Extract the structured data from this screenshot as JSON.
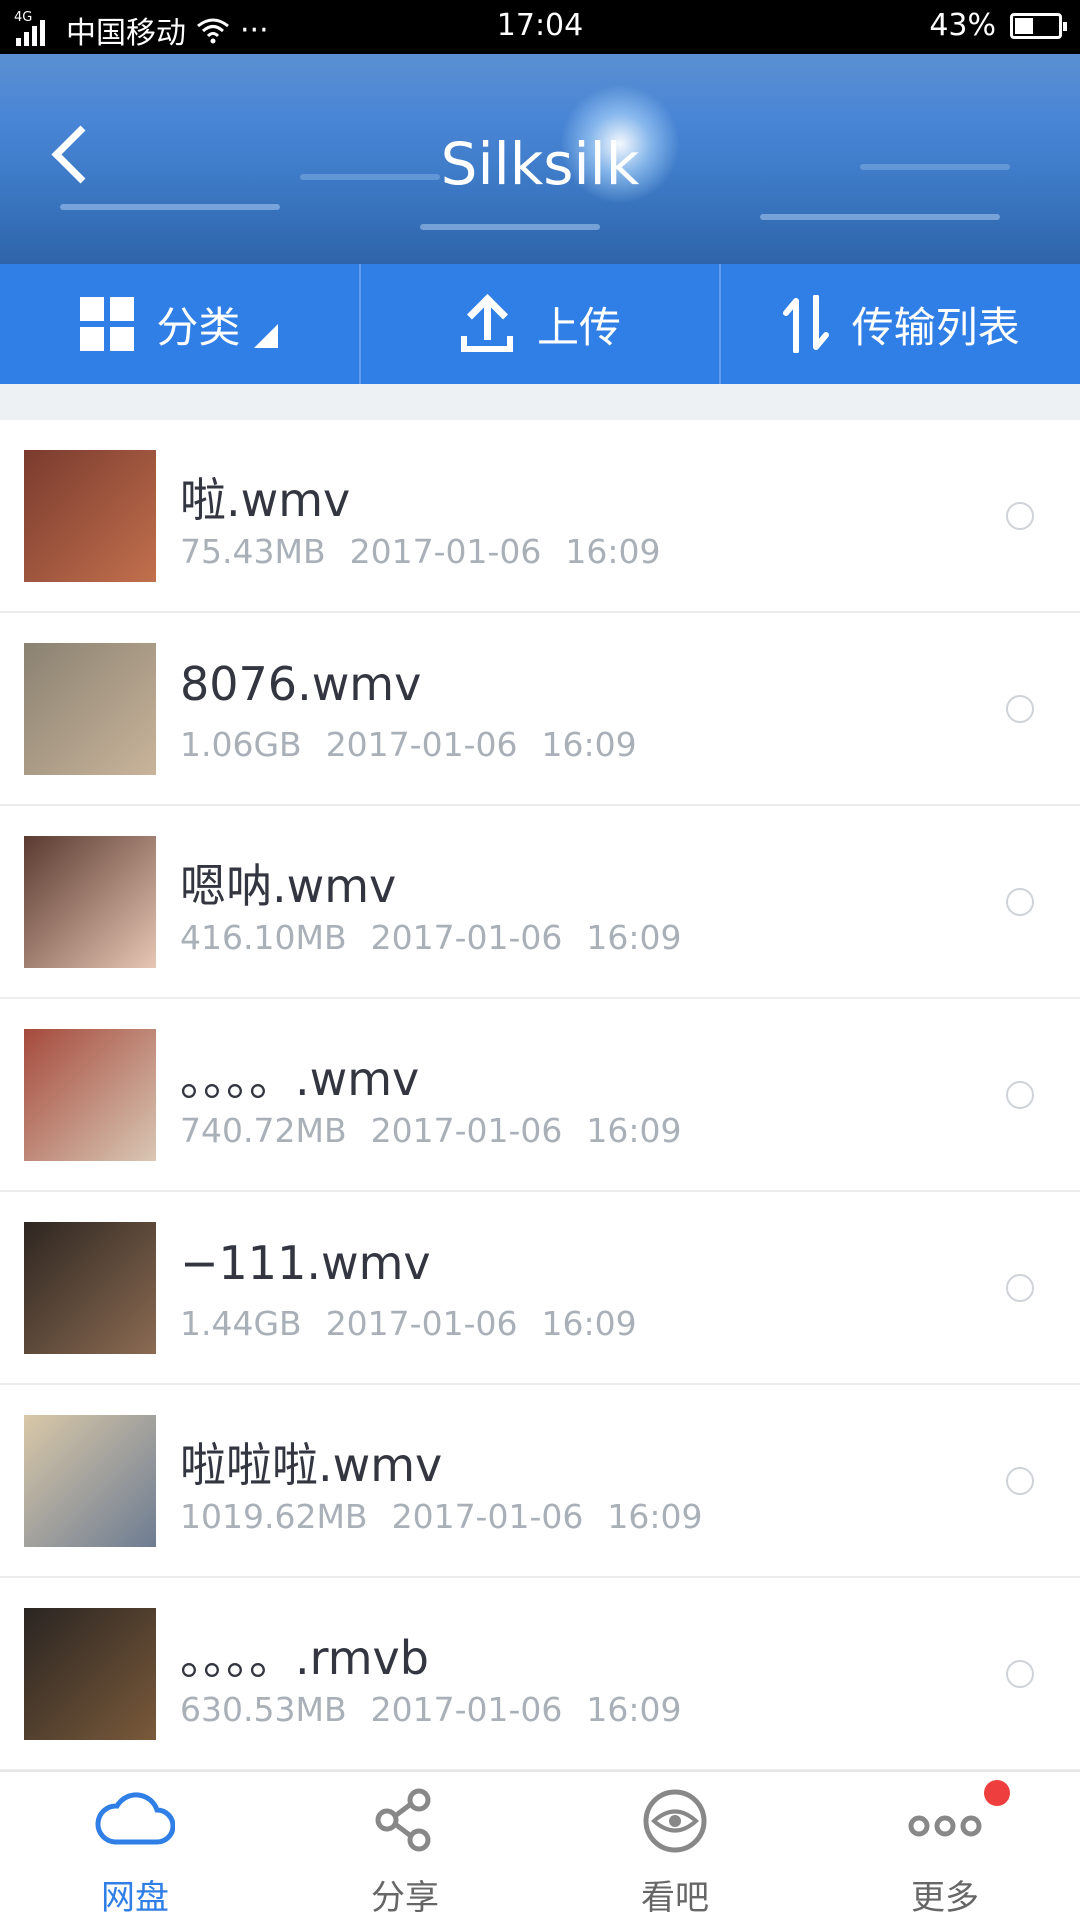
{
  "status_bar": {
    "network_badge": "4G",
    "carrier": "中国移动",
    "more": "···",
    "time": "17:04",
    "battery_percent": "43%",
    "battery_level": 0.43
  },
  "header": {
    "title": "Silksilk"
  },
  "toolbar": {
    "category_label": "分类",
    "upload_label": "上传",
    "transfer_label": "传输列表"
  },
  "files": [
    {
      "name": "啦.wmv",
      "size": "75.43MB",
      "date": "2017-01-06",
      "time": "16:09",
      "thumb_colors": [
        "#7a3b2e",
        "#c2704d"
      ]
    },
    {
      "name": "8076.wmv",
      "size": "1.06GB",
      "date": "2017-01-06",
      "time": "16:09",
      "thumb_colors": [
        "#8b8272",
        "#c9b49a"
      ]
    },
    {
      "name": "嗯呐.wmv",
      "size": "416.10MB",
      "date": "2017-01-06",
      "time": "16:09",
      "thumb_colors": [
        "#5a3a30",
        "#e8c6b4"
      ]
    },
    {
      "name": "。。。。.wmv",
      "size": "740.72MB",
      "date": "2017-01-06",
      "time": "16:09",
      "thumb_colors": [
        "#a54a3c",
        "#d9c7b4"
      ]
    },
    {
      "name": "−111.wmv",
      "size": "1.44GB",
      "date": "2017-01-06",
      "time": "16:09",
      "thumb_colors": [
        "#2e2621",
        "#8b6b52"
      ]
    },
    {
      "name": "啦啦啦.wmv",
      "size": "1019.62MB",
      "date": "2017-01-06",
      "time": "16:09",
      "thumb_colors": [
        "#d9c8a8",
        "#6d7c92"
      ]
    },
    {
      "name": "。。。。.rmvb",
      "size": "630.53MB",
      "date": "2017-01-06",
      "time": "16:09",
      "thumb_colors": [
        "#2a2522",
        "#7a5a3a"
      ]
    }
  ],
  "tabbar": {
    "tabs": [
      {
        "label": "网盘",
        "icon": "cloud-icon",
        "active": true
      },
      {
        "label": "分享",
        "icon": "share-icon",
        "active": false
      },
      {
        "label": "看吧",
        "icon": "eye-icon",
        "active": false
      },
      {
        "label": "更多",
        "icon": "more-dots-icon",
        "active": false
      }
    ]
  },
  "colors": {
    "accent": "#2f7fe6",
    "badge": "#ef3e3e"
  }
}
